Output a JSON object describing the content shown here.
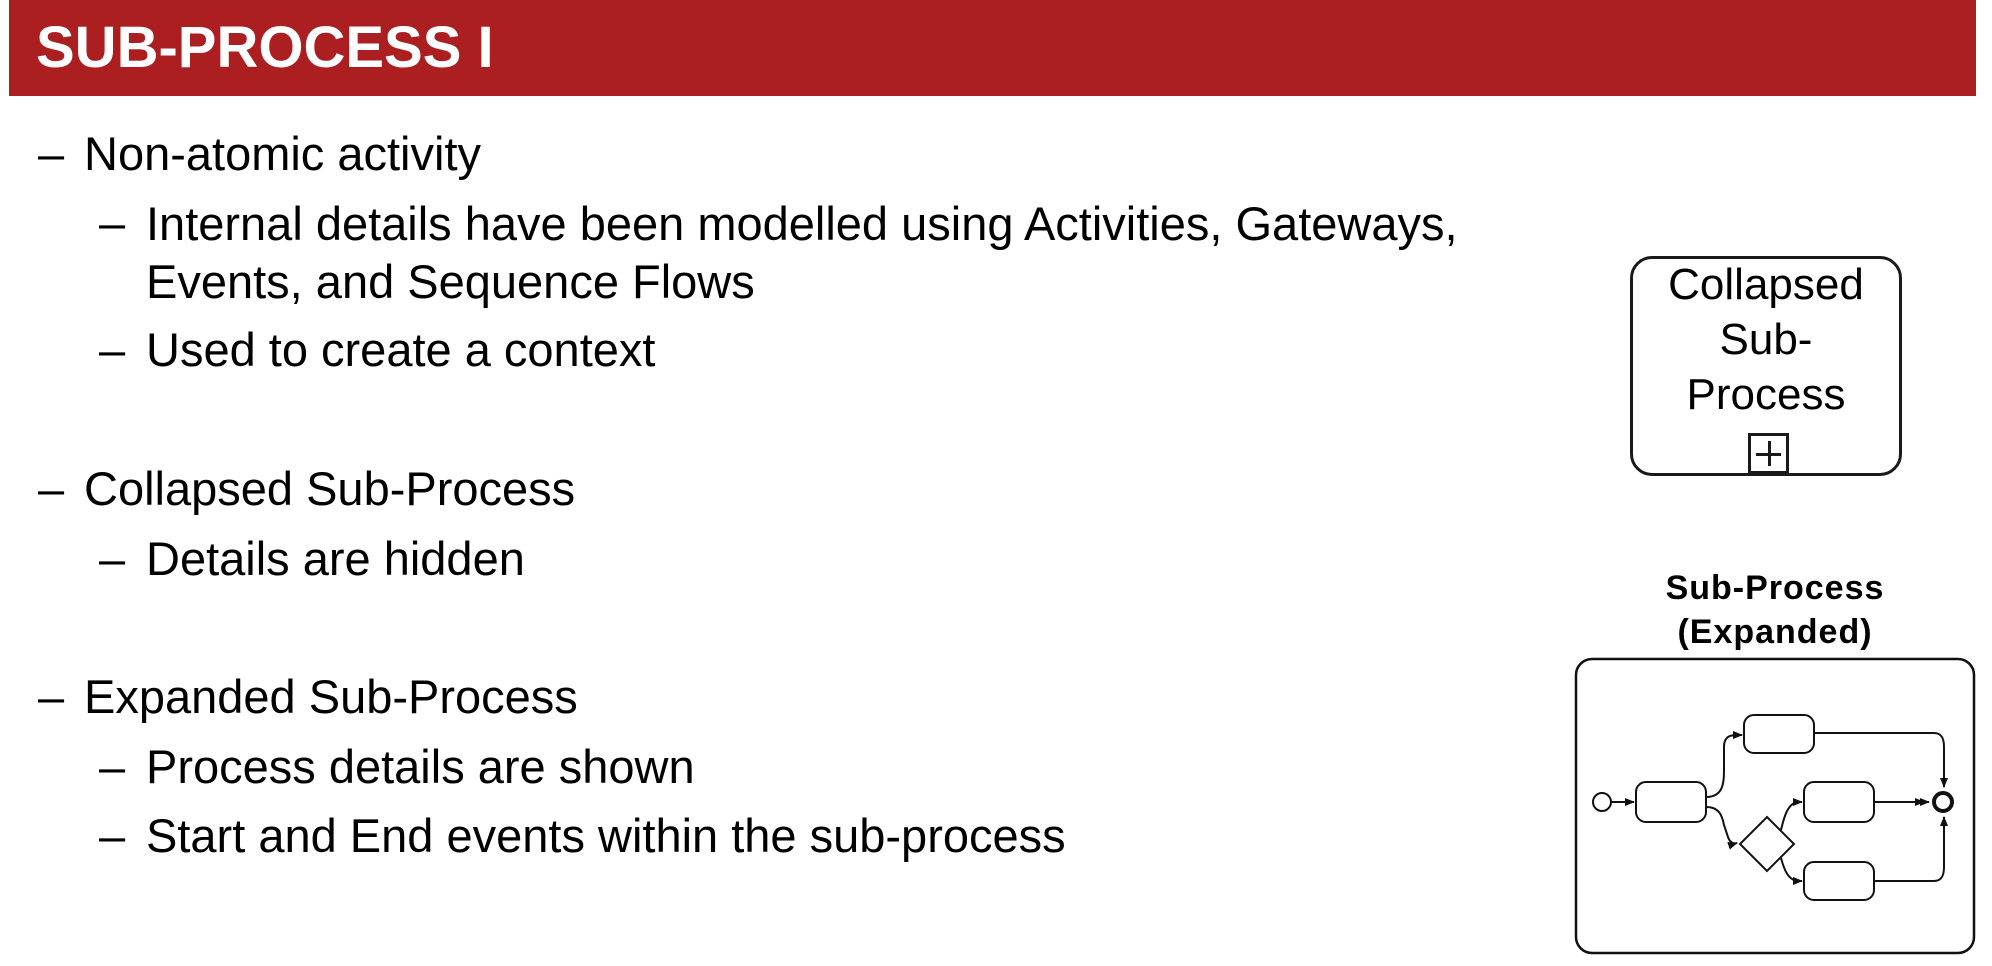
{
  "slide": {
    "title": "SUB-PROCESS I",
    "accent_color": "#ab1f21"
  },
  "bullets": [
    {
      "text": "Non-atomic activity",
      "children": [
        {
          "lines": [
            "Internal details have been modelled using Activities, Gateways,",
            "Events, and Sequence Flows"
          ]
        },
        {
          "lines": [
            "Used to create a context"
          ]
        }
      ]
    },
    {
      "text": "Collapsed Sub-Process",
      "children": [
        {
          "lines": [
            "Details are hidden"
          ]
        }
      ]
    },
    {
      "text": "Expanded Sub-Process",
      "children": [
        {
          "lines": [
            "Process details are shown"
          ]
        },
        {
          "lines": [
            "Start and End events within the sub-process"
          ]
        }
      ]
    }
  ],
  "bullet_marker": "–",
  "collapsed_figure": {
    "label_lines": [
      "Collapsed",
      "Sub-",
      "Process"
    ],
    "marker_icon": "plus-square-icon"
  },
  "expanded_figure": {
    "caption_lines": [
      "Sub-Process",
      "(Expanded)"
    ]
  }
}
